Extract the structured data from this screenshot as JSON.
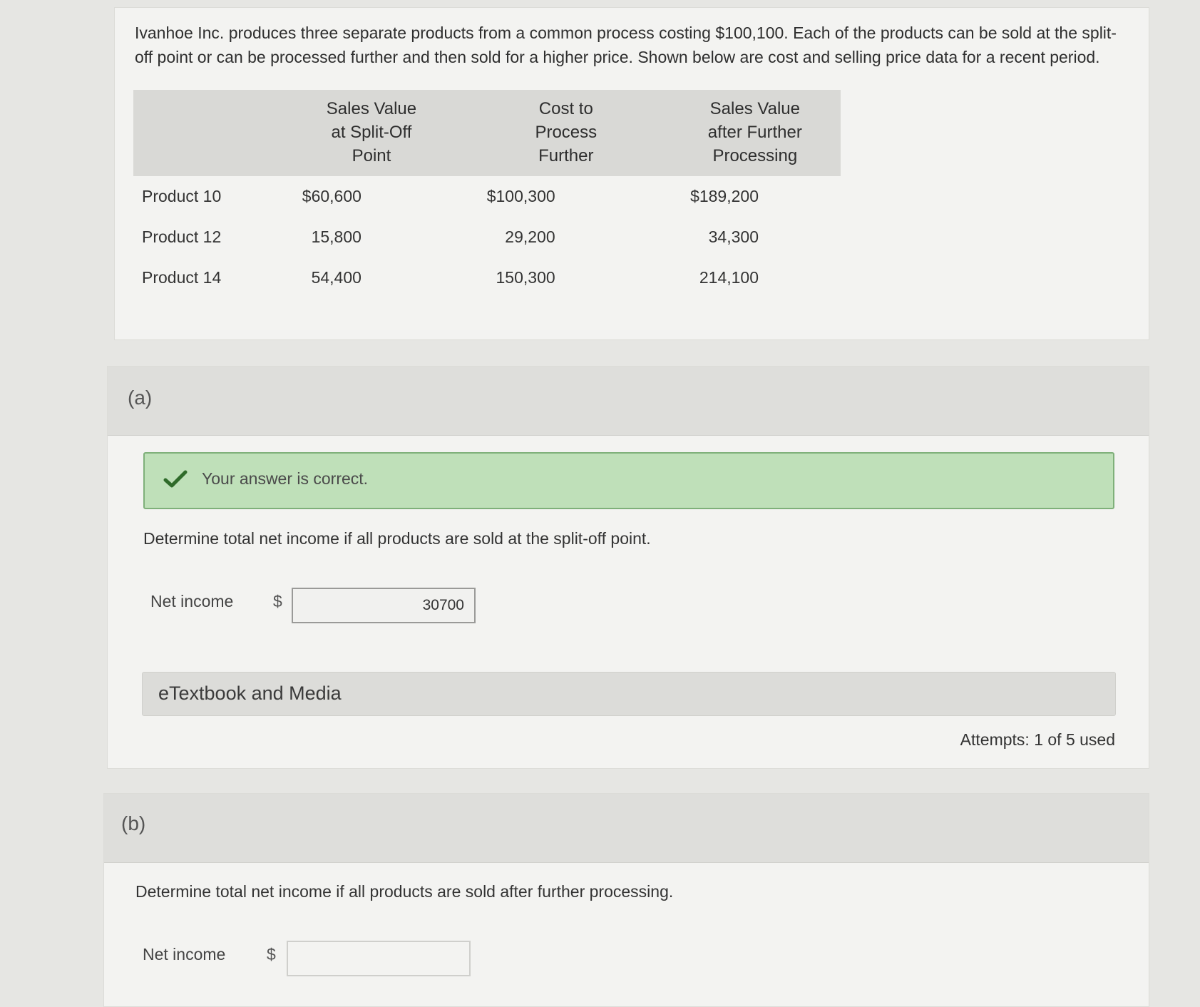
{
  "problem": {
    "intro": "Ivanhoe Inc. produces three separate products from a common process costing $100,100. Each of the products can be sold at the split-off point or can be processed further and then sold for a higher price. Shown below are cost and selling price data for a recent period.",
    "table": {
      "headers": [
        "",
        "Sales Value at Split-Off Point",
        "Cost to Process Further",
        "Sales Value after Further Processing"
      ],
      "header_lines": [
        [],
        [
          "Sales Value",
          "at Split-Off",
          "Point"
        ],
        [
          "Cost to",
          "Process",
          "Further"
        ],
        [
          "Sales Value",
          "after Further",
          "Processing"
        ]
      ],
      "rows": [
        {
          "product": "Product 10",
          "split_off": "$60,600",
          "cost_further": "$100,300",
          "after_further": "$189,200"
        },
        {
          "product": "Product 12",
          "split_off": "15,800",
          "cost_further": "29,200",
          "after_further": "34,300"
        },
        {
          "product": "Product 14",
          "split_off": "54,400",
          "cost_further": "150,300",
          "after_further": "214,100"
        }
      ]
    }
  },
  "part_a": {
    "label": "(a)",
    "feedback": "Your answer is correct.",
    "question": "Determine total net income if all products are sold at the split-off point.",
    "net_income_label": "Net income",
    "currency": "$",
    "answer_value": "30700",
    "etextbook_label": "eTextbook and Media",
    "attempts": "Attempts: 1 of 5 used"
  },
  "part_b": {
    "label": "(b)",
    "question": "Determine total net income if all products are sold after further processing.",
    "net_income_label": "Net income",
    "currency": "$",
    "answer_value": ""
  },
  "colors": {
    "feedback_bg": "#bfe0b9",
    "feedback_border": "#7fb07a",
    "check": "#2f6b2a"
  }
}
